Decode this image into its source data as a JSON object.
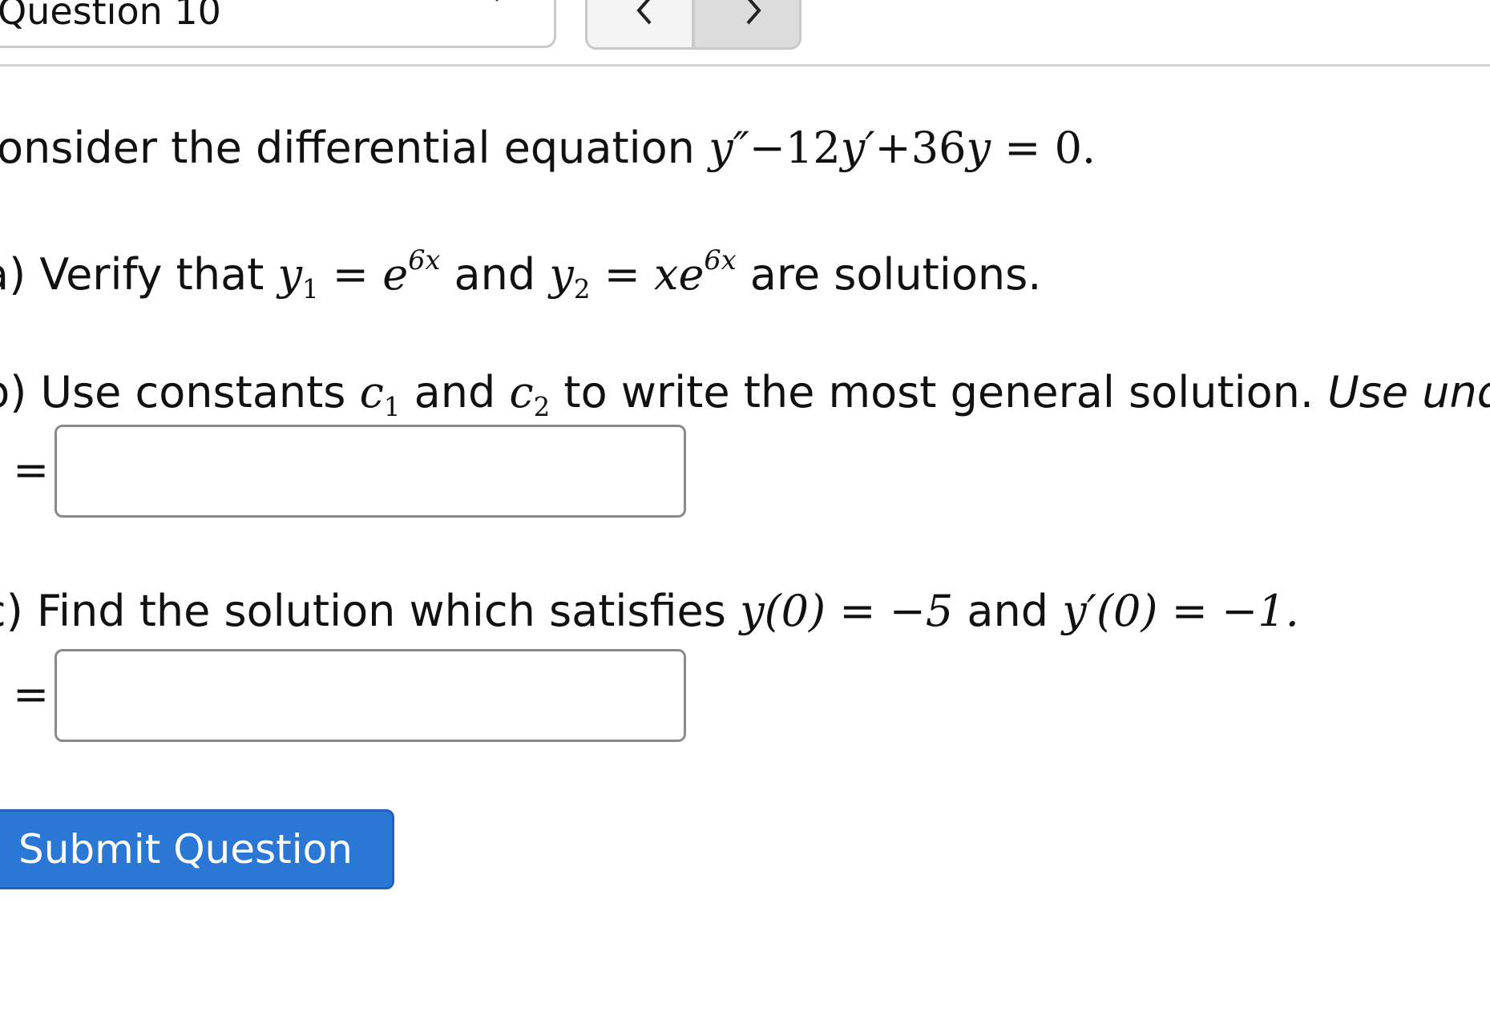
{
  "nav": {
    "question_select_label": "Question 10",
    "prev_icon": "chevron-left-icon",
    "next_icon": "chevron-right-icon",
    "dropdown_icon": "chevron-down-icon"
  },
  "intro": {
    "text": "onsider the differential equation ",
    "math": [
      "y″",
      "−12",
      "y′",
      "+36",
      "y",
      " = 0."
    ]
  },
  "part_a": {
    "label": "a) Verify that ",
    "y1": "y",
    "y1_sub": "1",
    "eq1": " = ",
    "e1": "e",
    "e1_sup": "6x",
    "and": " and ",
    "y2": "y",
    "y2_sub": "2",
    "eq2": " = ",
    "xe": "xe",
    "e2_sup": "6x",
    "tail": " are solutions."
  },
  "part_b": {
    "label": "b) Use constants ",
    "c1": "c",
    "c1_sub": "1",
    "and": " and ",
    "c2": "c",
    "c2_sub": "2",
    "tail": " to write the most general solution. ",
    "italic_tail": "Use under",
    "eq_sign": "=",
    "answer_value": ""
  },
  "part_c": {
    "label": "c) Find the solution which satisfies ",
    "cond1": "y(0) = −5",
    "and": " and ",
    "cond2": "y′(0) = −1.",
    "eq_sign": "=",
    "answer_value": ""
  },
  "submit": {
    "label": "Submit Question"
  },
  "colors": {
    "submit_bg": "#2a77d6",
    "border": "#c9c9c9",
    "text": "#111111"
  }
}
